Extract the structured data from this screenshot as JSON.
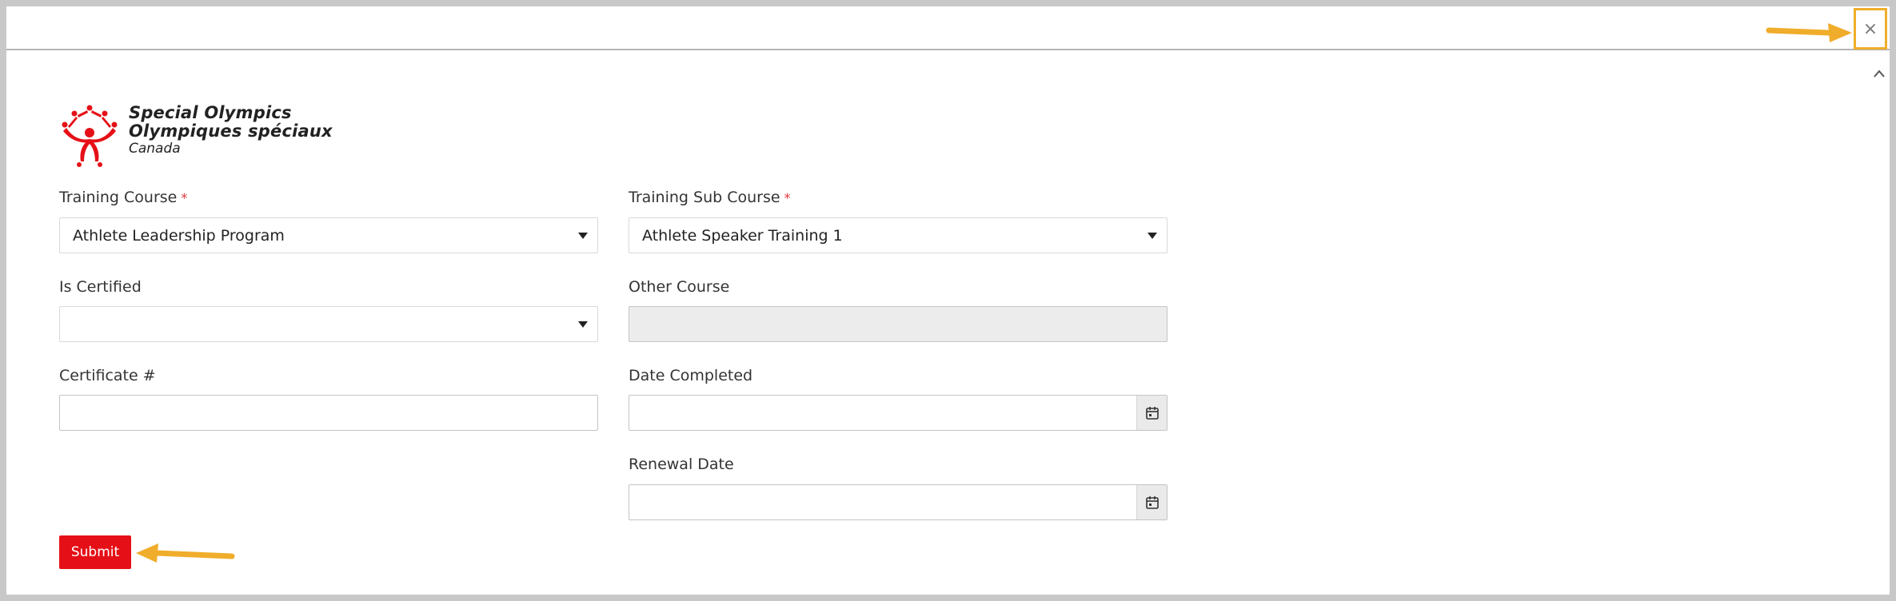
{
  "logo": {
    "line1": "Special Olympics",
    "line2": "Olympiques spéciaux",
    "line3": "Canada"
  },
  "header": {
    "close_symbol": "×"
  },
  "form": {
    "training_course": {
      "label": "Training Course",
      "required": "*",
      "value": "Athlete Leadership Program"
    },
    "training_sub_course": {
      "label": "Training Sub Course",
      "required": "*",
      "value": "Athlete Speaker Training 1"
    },
    "is_certified": {
      "label": "Is Certified",
      "value": ""
    },
    "other_course": {
      "label": "Other Course",
      "value": ""
    },
    "certificate_number": {
      "label": "Certificate #",
      "value": ""
    },
    "date_completed": {
      "label": "Date Completed",
      "value": ""
    },
    "renewal_date": {
      "label": "Renewal Date",
      "value": ""
    },
    "submit_label": "Submit"
  },
  "colors": {
    "brand_red": "#e51017",
    "highlight": "#f0ad2b",
    "required": "#e0353b"
  },
  "icons": [
    "close-icon",
    "calendar-icon",
    "chevron-up-icon",
    "caret-down-icon",
    "special-olympics-logo-icon"
  ]
}
